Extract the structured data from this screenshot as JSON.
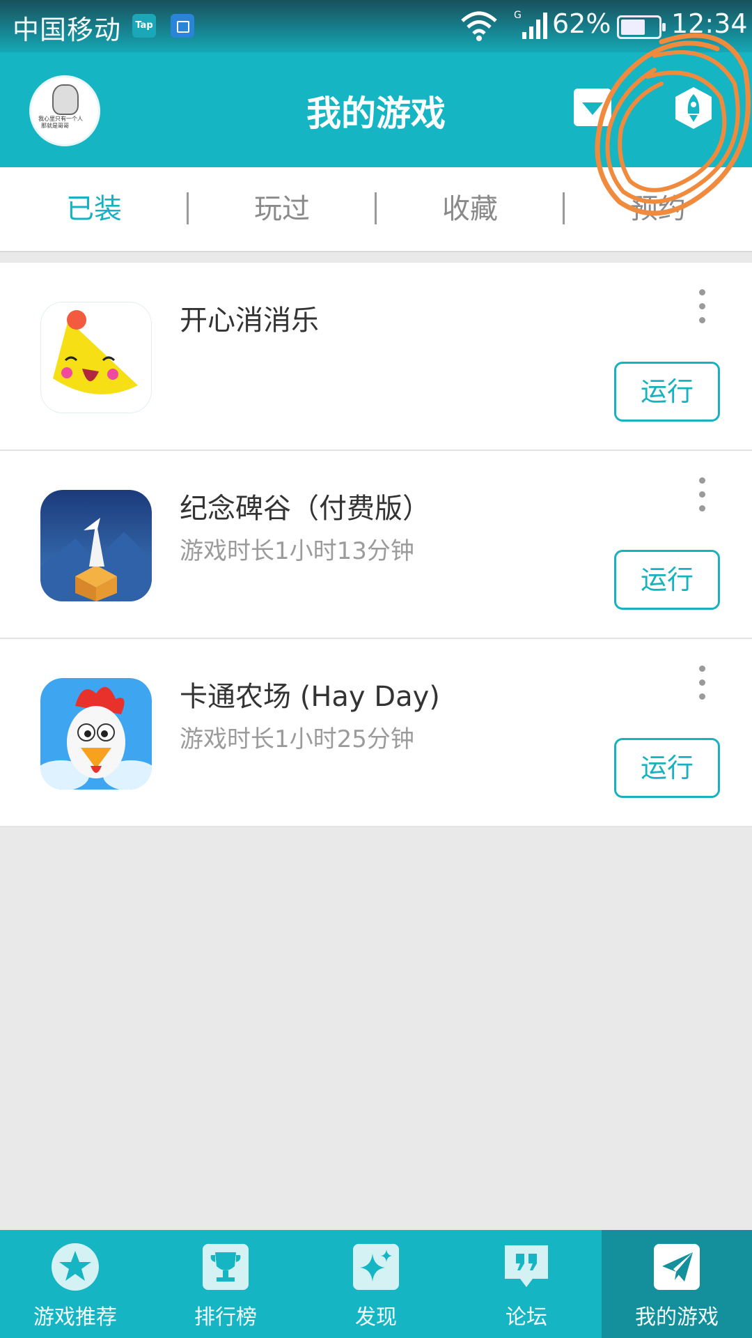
{
  "status_bar": {
    "carrier": "中国移动",
    "tap_label": "Tap",
    "network_type": "G",
    "battery": "62%",
    "time": "12:34"
  },
  "header": {
    "title": "我的游戏",
    "avatar_text_line1": "我心里只有一个人",
    "avatar_text_line2": "那就是哥哥"
  },
  "tabs": [
    {
      "label": "已装",
      "active": true
    },
    {
      "label": "玩过",
      "active": false
    },
    {
      "label": "收藏",
      "active": false
    },
    {
      "label": "预约",
      "active": false
    }
  ],
  "games": [
    {
      "title": "开心消消乐",
      "playtime": "",
      "action": "运行"
    },
    {
      "title": "纪念碑谷（付费版）",
      "playtime": "游戏时长1小时13分钟",
      "action": "运行"
    },
    {
      "title": "卡通农场 (Hay Day)",
      "playtime": "游戏时长1小时25分钟",
      "action": "运行"
    }
  ],
  "bottom_nav": [
    {
      "label": "游戏推荐",
      "icon": "star-icon",
      "active": false
    },
    {
      "label": "排行榜",
      "icon": "trophy-icon",
      "active": false
    },
    {
      "label": "发现",
      "icon": "sparkle-icon",
      "active": false
    },
    {
      "label": "论坛",
      "icon": "quote-icon",
      "active": false
    },
    {
      "label": "我的游戏",
      "icon": "paper-plane-icon",
      "active": true
    }
  ],
  "colors": {
    "accent": "#16b5c3",
    "accent_dark": "#148f9c",
    "annotation": "#f08a3c"
  }
}
